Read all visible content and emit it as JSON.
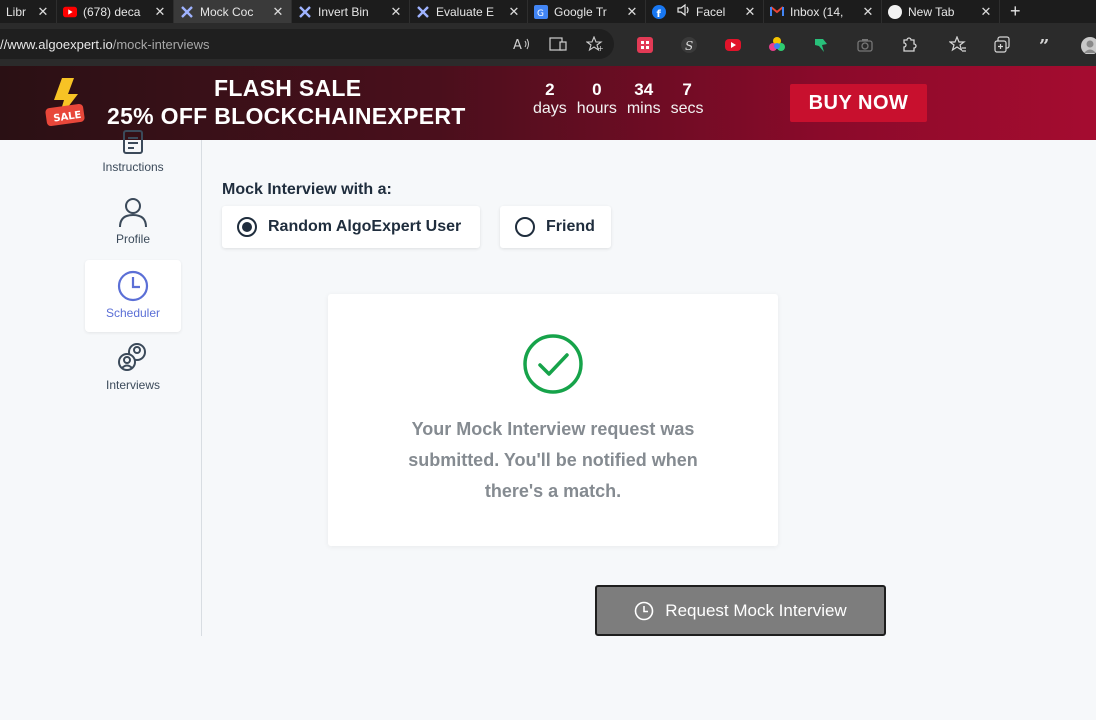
{
  "browser": {
    "tabs": [
      {
        "title": "Libr",
        "icon": "library-icon",
        "active": false
      },
      {
        "title": "(678) deca",
        "icon": "youtube-icon",
        "active": false
      },
      {
        "title": "Mock Coc",
        "icon": "algoexpert-icon",
        "active": true
      },
      {
        "title": "Invert Bin",
        "icon": "algoexpert-icon",
        "active": false
      },
      {
        "title": "Evaluate E",
        "icon": "algoexpert-icon",
        "active": false
      },
      {
        "title": "Google Tr",
        "icon": "google-translate-icon",
        "active": false
      },
      {
        "title": "Facel",
        "icon": "facebook-icon",
        "active": false
      },
      {
        "title": "Inbox (14,",
        "icon": "gmail-icon",
        "active": false
      },
      {
        "title": "New Tab",
        "icon": "newtab-icon",
        "active": false
      }
    ],
    "url_host": "//www.algoexpert.io",
    "url_path": "/mock-interviews"
  },
  "banner": {
    "line1": "FLASH SALE",
    "line2": "25% OFF BLOCKCHAINEXPERT",
    "badge_text": "SALE",
    "countdown": [
      {
        "value": "2",
        "label": "days"
      },
      {
        "value": "0",
        "label": "hours"
      },
      {
        "value": "34",
        "label": "mins"
      },
      {
        "value": "7",
        "label": "secs"
      }
    ],
    "buy_label": "BUY NOW"
  },
  "sidebar": {
    "items": [
      {
        "label": "Instructions",
        "icon": "document-icon"
      },
      {
        "label": "Profile",
        "icon": "user-icon"
      },
      {
        "label": "Scheduler",
        "icon": "clock-icon",
        "active": true
      },
      {
        "label": "Interviews",
        "icon": "people-icon"
      }
    ]
  },
  "main": {
    "mock_label": "Mock Interview with a:",
    "options": [
      {
        "label": "Random AlgoExpert User",
        "selected": true
      },
      {
        "label": "Friend",
        "selected": false
      }
    ],
    "success_message": "Your Mock Interview request was submitted. You'll be notified when there's a match.",
    "request_button": "Request Mock Interview"
  },
  "colors": {
    "accent_green": "#16a34a",
    "sale_red": "#c8102e",
    "scheduler_blue": "#5b6fd6"
  }
}
